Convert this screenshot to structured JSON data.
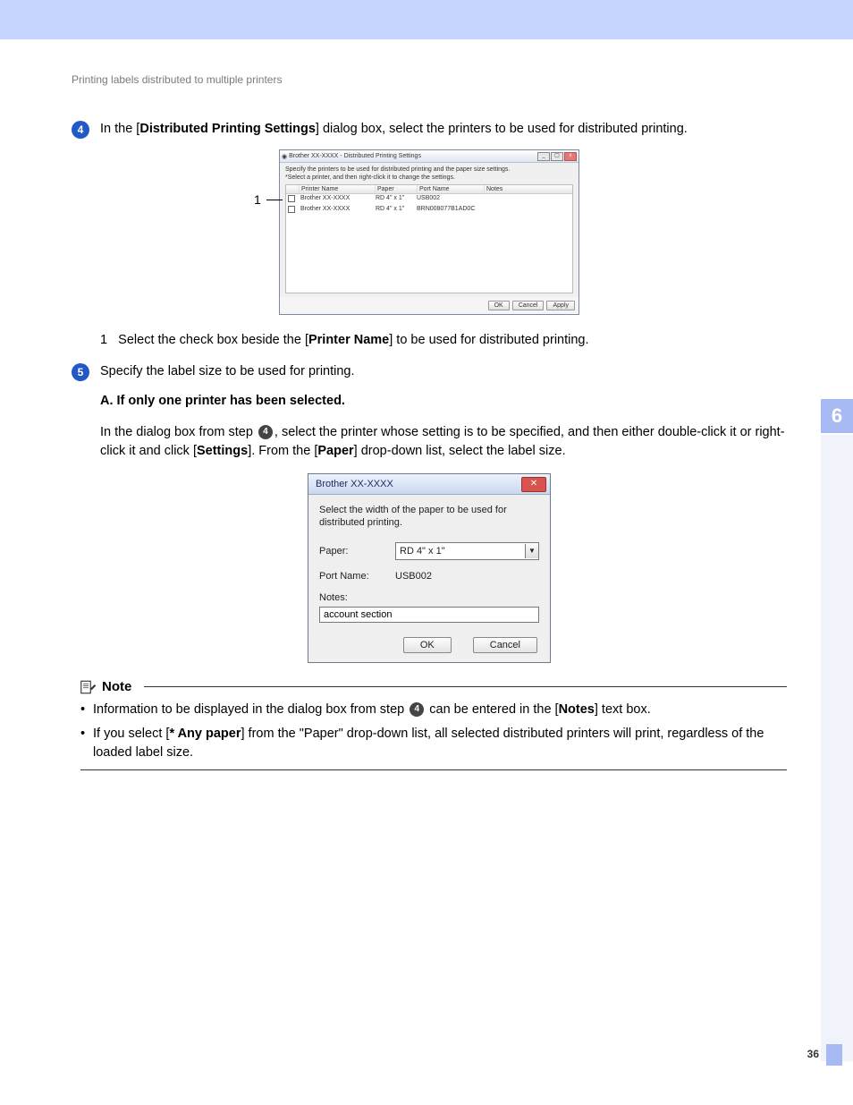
{
  "breadcrumb": "Printing labels distributed to multiple printers",
  "chapter": "6",
  "page_number": "36",
  "step4": {
    "num": "4",
    "t1": "In the [",
    "b1": "Distributed Printing Settings",
    "t2": "] dialog box, select the printers to be used for distributed printing."
  },
  "fig1": {
    "callout": "1",
    "title": "Brother XX-XXXX - Distributed Printing Settings",
    "hint": "Specify the printers to be used for distributed printing and the paper size settings.",
    "hint2": "*Select a printer, and then right-click it to change the settings.",
    "cols": {
      "name": "Printer Name",
      "paper": "Paper",
      "port": "Port Name",
      "notes": "Notes"
    },
    "rows": [
      {
        "name": "Brother XX-XXXX",
        "paper": "RD 4\" x 1\"",
        "port": "USB002",
        "notes": ""
      },
      {
        "name": "Brother XX-XXXX",
        "paper": "RD 4\" x 1\"",
        "port": "BRN008077B1AD0C",
        "notes": ""
      }
    ],
    "ok": "OK",
    "cancel": "Cancel",
    "apply": "Apply"
  },
  "sub1": {
    "n": "1",
    "t1": "Select the check box beside the [",
    "b1": "Printer Name",
    "t2": "] to be used for distributed printing."
  },
  "step5": {
    "num": "5",
    "text": "Specify the label size to be used for printing."
  },
  "sectA": "A. If only one printer has been selected.",
  "para1": {
    "t1": "In the dialog box from step ",
    "ref": "4",
    "t2": ", select the printer whose setting is to be specified, and then either double-click it or right-click it and click [",
    "b1": "Settings",
    "t3": "]. From the [",
    "b2": "Paper",
    "t4": "] drop-down list, select the label size."
  },
  "fig2": {
    "title": "Brother XX-XXXX",
    "desc": "Select the width of the paper to be used for distributed printing.",
    "paper_label": "Paper:",
    "paper_value": "RD 4\" x 1\"",
    "port_label": "Port Name:",
    "port_value": "USB002",
    "notes_label": "Notes:",
    "notes_value": "account section",
    "ok": "OK",
    "cancel": "Cancel"
  },
  "note": {
    "title": "Note",
    "i1": {
      "t1": "Information to be displayed in the dialog box from step ",
      "ref": "4",
      "t2": " can be entered in the [",
      "b1": "Notes",
      "t3": "] text box."
    },
    "i2": {
      "t1": "If you select [",
      "b1": "* Any paper",
      "t2": "] from the \"Paper\" drop-down list, all selected distributed printers will print, regardless of the loaded label size."
    }
  }
}
